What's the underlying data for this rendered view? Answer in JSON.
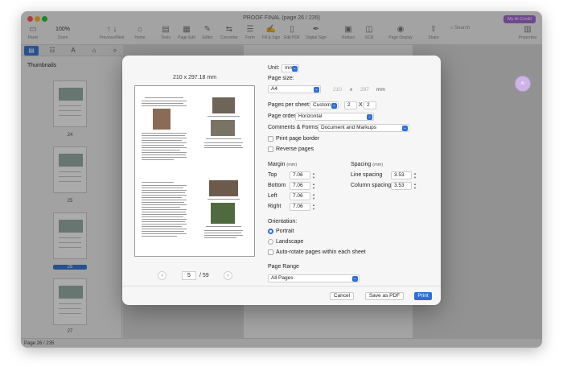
{
  "window": {
    "title": "PROOF FINAL (page 26 / 235)",
    "ai_credit": "My AI Credit",
    "zoom": "100%",
    "toolbar": [
      "Panel",
      "Zoom",
      "Previous/Next",
      "Home",
      "Tools",
      "Page Edit",
      "Editor",
      "Converter",
      "Form",
      "Fill & Sign",
      "Edit PDF",
      "Digital Sign",
      "Redact",
      "OCR",
      "Page Display",
      "Share",
      "Search",
      "Properties"
    ],
    "search_placeholder": "Search"
  },
  "sidebar": {
    "title": "Thumbnails",
    "pages": [
      "24",
      "25",
      "26",
      "27"
    ]
  },
  "status": "Page 26 / 235",
  "ai_bubble": "AI",
  "dialog": {
    "preview_size": "210 x 297.18 mm",
    "pager": {
      "current": "5",
      "total": "/ 59"
    },
    "unit_label": "Unit:",
    "unit_value": "mm",
    "page_size_label": "Page size:",
    "page_size_value": "A4",
    "width": "210",
    "x": "x",
    "height": "297",
    "height_unit": "mm",
    "pages_per_sheet_label": "Pages per sheet:",
    "pages_per_sheet_value": "Custom",
    "pps_cols": "2",
    "pps_x": "X",
    "pps_rows": "2",
    "page_order_label": "Page order:",
    "page_order_value": "Horizontal",
    "comments_label": "Comments & Forms:",
    "comments_value": "Document and Markups",
    "print_border": "Print page border",
    "reverse_pages": "Reverse pages",
    "margin_label": "Margin",
    "margin_unit": "(mm)",
    "margins": [
      {
        "label": "Top",
        "value": "7.06"
      },
      {
        "label": "Bottom",
        "value": "7.06"
      },
      {
        "label": "Left",
        "value": "7.06"
      },
      {
        "label": "Right",
        "value": "7.06"
      }
    ],
    "spacing_label": "Spacing",
    "spacing_unit": "(mm)",
    "line_spacing_label": "Line spacing",
    "line_spacing_value": "3.53",
    "column_spacing_label": "Column spacing",
    "column_spacing_value": "3.53",
    "orientation_label": "Orientation:",
    "portrait": "Portrait",
    "landscape": "Landscape",
    "auto_rotate": "Auto-rotate pages within each sheet",
    "page_range_label": "Page Range",
    "page_range_value": "All Pages",
    "cancel": "Cancel",
    "save_as_pdf": "Save as PDF",
    "print": "Print"
  }
}
